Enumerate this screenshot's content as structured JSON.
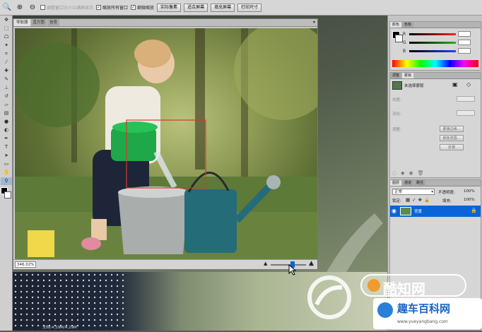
{
  "options_bar": {
    "resize_windows": "调整窗口大小以满屏显示",
    "zoom_all_windows": "缩放所有窗口",
    "scrubby_zoom": "细微缩放",
    "actual_pixels": "实际像素",
    "fit_screen": "适合屏幕",
    "fill_screen": "填充屏幕",
    "print_size": "打印尺寸"
  },
  "document": {
    "tabs": [
      {
        "label": "导航器"
      },
      {
        "label": "直方图"
      },
      {
        "label": "信息"
      }
    ],
    "zoom": "346.02%",
    "status_text": "文档:4.29M/4.29M"
  },
  "color_panel": {
    "tabs": [
      {
        "label": "颜色"
      },
      {
        "label": "色板"
      }
    ],
    "channels": [
      {
        "label": "R",
        "color": "#ff2020"
      },
      {
        "label": "G",
        "color": "#20b020"
      },
      {
        "label": "B",
        "color": "#2040ff"
      }
    ]
  },
  "masks_panel": {
    "tabs": [
      {
        "label": "调整"
      },
      {
        "label": "蒙版"
      }
    ],
    "title": "未选择蒙版",
    "density_label": "浓度:",
    "feather_label": "羽化:",
    "refine_label": "调整:",
    "mask_edge": "蒙版边缘...",
    "color_range": "颜色范围...",
    "invert": "反相"
  },
  "layers_panel": {
    "tabs": [
      {
        "label": "图层"
      },
      {
        "label": "通道"
      },
      {
        "label": "路径"
      }
    ],
    "blend_mode": "正常",
    "opacity_label": "不透明度:",
    "opacity": "100%",
    "lock_label": "锁定:",
    "fill_label": "填充:",
    "fill": "100%",
    "layer_name": "背景"
  },
  "watermark": {
    "brand_cn": "酷知网",
    "site_cn": "趣车百科网",
    "site_url": "www.yueyangbang.com"
  },
  "colors": {
    "accent_blue": "#0a64d8",
    "selection_red": "#d23b2a"
  }
}
